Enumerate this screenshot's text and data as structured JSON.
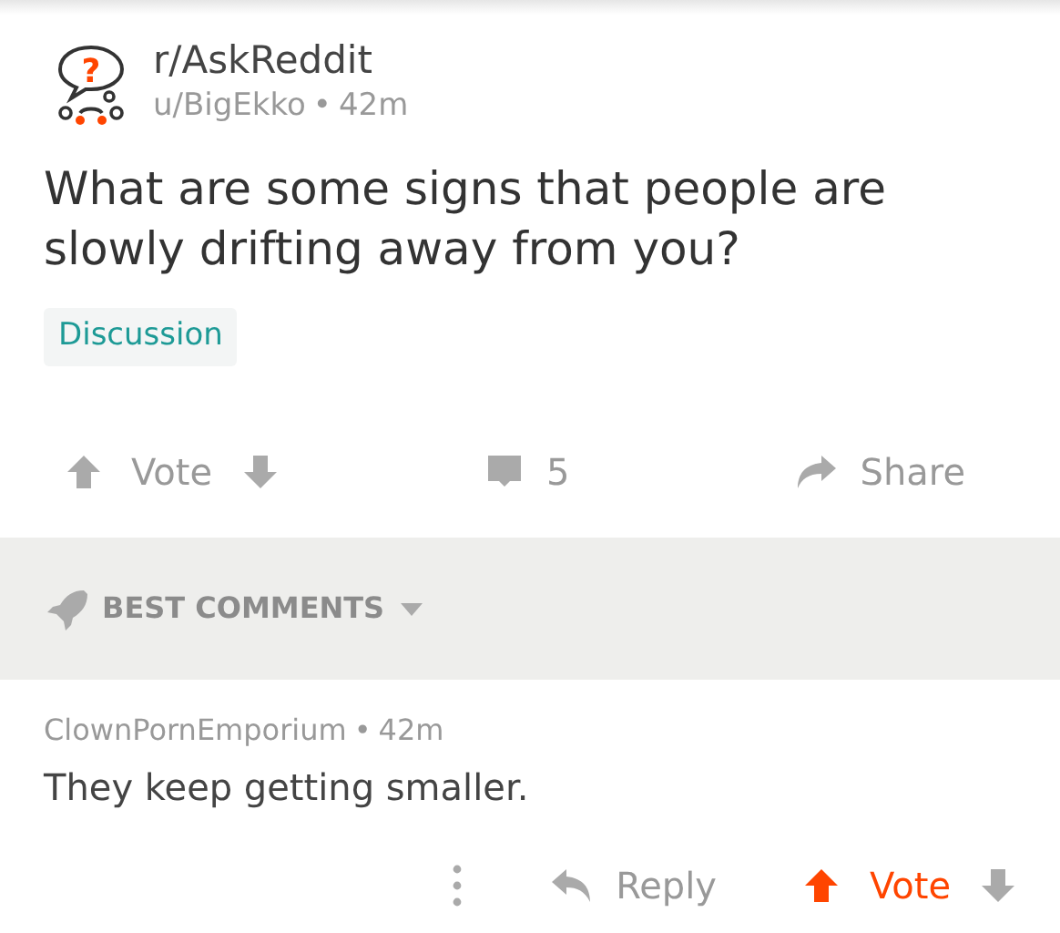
{
  "post": {
    "icon_glyph": "?",
    "subreddit": "r/AskReddit",
    "author": "u/BigEkko",
    "separator": "•",
    "age": "42m",
    "title": "What are some signs that people are slowly drifting away from you?",
    "flair": "Discussion",
    "vote_label": "Vote",
    "upvoted": false,
    "comment_count": "5",
    "share_label": "Share"
  },
  "sort": {
    "label": "BEST COMMENTS"
  },
  "comments": [
    {
      "author": "ClownPornEmporium",
      "separator": "•",
      "age": "42m",
      "body": "They keep getting smaller.",
      "reply_label": "Reply",
      "vote_label": "Vote",
      "upvoted": true
    }
  ]
}
